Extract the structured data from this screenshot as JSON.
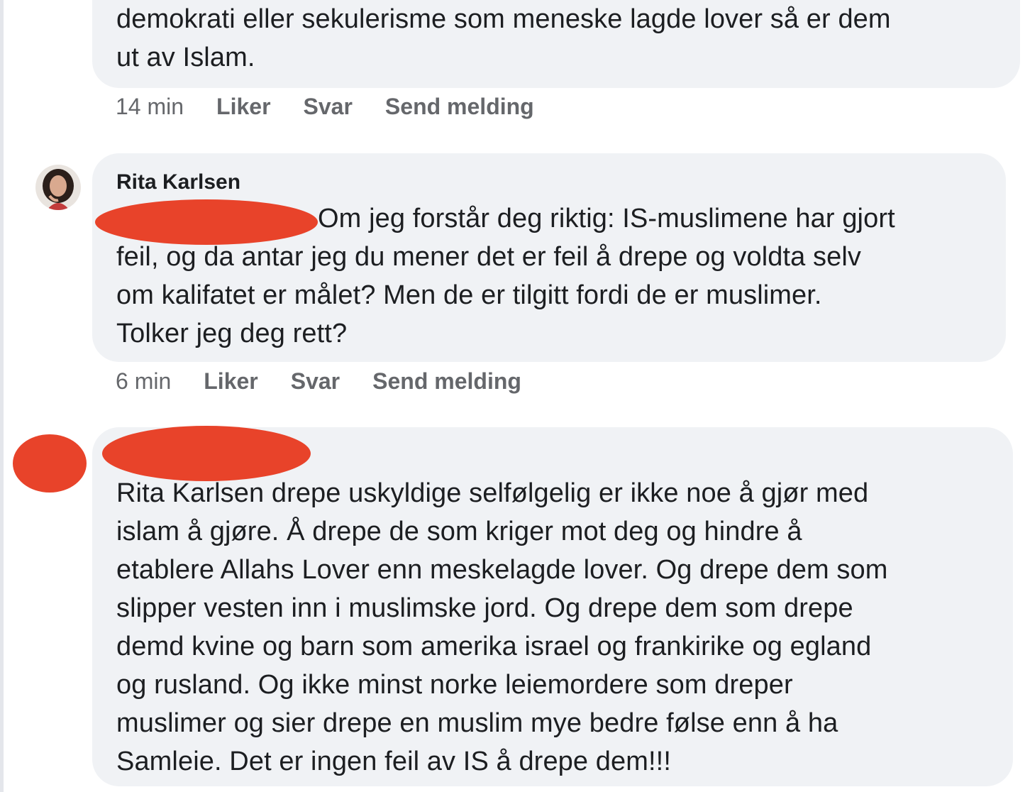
{
  "comments": [
    {
      "author": "",
      "text_lines": [
        "demokrati eller sekulerisme som meneske lagde lover så er dem",
        "ut av Islam."
      ],
      "time": "14 min",
      "like_label": "Liker",
      "reply_label": "Svar",
      "message_label": "Send melding"
    },
    {
      "author": "Rita Karlsen",
      "text_lines": [
        "Om jeg forstår deg riktig: IS-muslimene har gjort",
        "feil, og da antar jeg du mener det er feil å drepe og voldta selv",
        "om kalifatet er målet? Men de er tilgitt fordi de er muslimer.",
        "Tolker jeg deg rett?"
      ],
      "time": "6 min",
      "like_label": "Liker",
      "reply_label": "Svar",
      "message_label": "Send melding"
    },
    {
      "author": "",
      "text_lines": [
        "Rita Karlsen drepe uskyldige selfølgelig er ikke noe å gjør med",
        "islam å gjøre. Å drepe de som kriger mot deg og hindre å",
        "etablere Allahs Lover enn meskelagde lover. Og drepe dem som",
        "slipper vesten inn i muslimske jord. Og drepe dem som drepe",
        "demd kvine og barn som amerika israel og frankirike og egland",
        "og rusland. Og ikke minst norke leiemordere som dreper",
        "muslimer og sier drepe en muslim mye bedre følse enn å ha",
        "Samleie. Det er ingen feil av IS å drepe dem!!!"
      ]
    }
  ],
  "colors": {
    "bubble_bg": "#f0f2f5",
    "text": "#1c1e21",
    "meta_text": "#65676b",
    "redaction": "#e8432a"
  }
}
